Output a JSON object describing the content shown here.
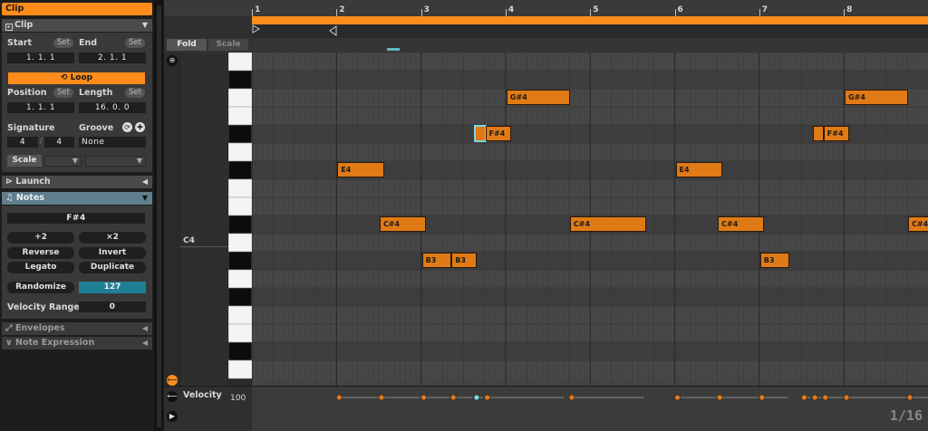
{
  "clip_panel": {
    "clip_header": "Clip",
    "clip_section": "Clip",
    "start_label": "Start",
    "end_label": "End",
    "set_label": "Set",
    "start_value": "1.   1.   1",
    "end_value": "2.   1.   1",
    "loop_label": "Loop",
    "position_label": "Position",
    "length_label": "Length",
    "position_value": "1.   1.   1",
    "length_value": "16.   0.   0",
    "signature_label": "Signature",
    "groove_label": "Groove",
    "sig_num": "4",
    "sig_den": "4",
    "groove_value": "None",
    "scale_label": "Scale"
  },
  "launch": {
    "label": "Launch"
  },
  "notes_panel": {
    "label": "Notes",
    "selected_note": "F#4",
    "plus2": "+2",
    "times2": "×2",
    "reverse": "Reverse",
    "invert": "Invert",
    "legato": "Legato",
    "duplicate": "Duplicate",
    "randomize": "Randomize",
    "randomize_value": "127",
    "velocity_range_label": "Velocity Range",
    "velocity_range_value": "0"
  },
  "envelopes": {
    "label": "Envelopes"
  },
  "note_expression": {
    "label": "Note Expression"
  },
  "editor": {
    "fold": "Fold",
    "scale": "Scale",
    "octave_label": "C4",
    "bars": [
      "1",
      "2",
      "3",
      "4",
      "5",
      "6",
      "7",
      "8"
    ],
    "velocity_label": "Velocity",
    "velocity_max": "100",
    "grid_resolution": "1/16"
  },
  "colors": {
    "accent": "#ff8c1a",
    "note_fill": "#e07a16",
    "selected_note": "#7fd6e0",
    "notes_header": "#607f8d",
    "randomize_value_bg": "#1e7f95"
  },
  "notes": [
    {
      "pitch": "G#4",
      "row": 2,
      "start": 3.0,
      "len": 0.75
    },
    {
      "pitch": "G#4",
      "row": 2,
      "start": 7.0,
      "len": 0.75
    },
    {
      "pitch": "",
      "row": 4,
      "start": 2.625,
      "len": 0.125,
      "selected": true
    },
    {
      "pitch": "F#4",
      "row": 4,
      "start": 2.75,
      "len": 0.3
    },
    {
      "pitch": "",
      "row": 4,
      "start": 6.625,
      "len": 0.125
    },
    {
      "pitch": "F#4",
      "row": 4,
      "start": 6.75,
      "len": 0.3
    },
    {
      "pitch": "E4",
      "row": 6,
      "start": 1.0,
      "len": 0.55
    },
    {
      "pitch": "E4",
      "row": 6,
      "start": 5.0,
      "len": 0.55
    },
    {
      "pitch": "C#4",
      "row": 9,
      "start": 1.5,
      "len": 0.55
    },
    {
      "pitch": "C#4",
      "row": 9,
      "start": 3.75,
      "len": 0.9
    },
    {
      "pitch": "C#4",
      "row": 9,
      "start": 5.5,
      "len": 0.55
    },
    {
      "pitch": "C#4",
      "row": 9,
      "start": 7.75,
      "len": 0.9
    },
    {
      "pitch": "B3",
      "row": 11,
      "start": 2.0,
      "len": 0.35
    },
    {
      "pitch": "B3",
      "row": 11,
      "start": 2.35,
      "len": 0.3
    },
    {
      "pitch": "B3",
      "row": 11,
      "start": 6.0,
      "len": 0.35
    }
  ],
  "velocities": [
    {
      "start": 1.0,
      "len": 0.55
    },
    {
      "start": 1.5,
      "len": 0.5
    },
    {
      "start": 2.0,
      "len": 0.35
    },
    {
      "start": 2.35,
      "len": 0.27
    },
    {
      "start": 2.625,
      "len": 0.12,
      "selected": true
    },
    {
      "start": 2.75,
      "len": 0.95
    },
    {
      "start": 3.75,
      "len": 0.9
    },
    {
      "start": 5.0,
      "len": 0.5
    },
    {
      "start": 5.5,
      "len": 0.5
    },
    {
      "start": 6.0,
      "len": 0.35
    },
    {
      "start": 6.5,
      "len": 0.12
    },
    {
      "start": 6.625,
      "len": 0.12
    },
    {
      "start": 6.75,
      "len": 0.25
    },
    {
      "start": 7.0,
      "len": 0.75
    },
    {
      "start": 7.75,
      "len": 0.9
    }
  ]
}
